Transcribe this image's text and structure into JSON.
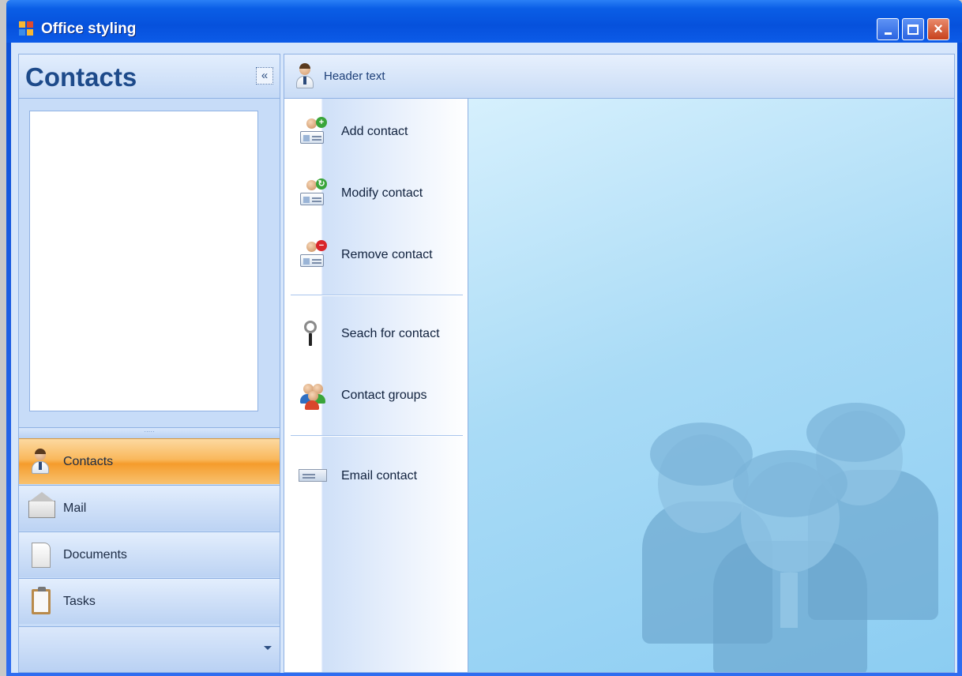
{
  "window": {
    "title": "Office styling"
  },
  "nav": {
    "title": "Contacts",
    "collapse_glyph": "«",
    "splitter_grip": "·····",
    "buttons": [
      {
        "label": "Contacts",
        "icon": "person-icon",
        "active": true
      },
      {
        "label": "Mail",
        "icon": "envelope-icon",
        "active": false
      },
      {
        "label": "Documents",
        "icon": "document-icon",
        "active": false
      },
      {
        "label": "Tasks",
        "icon": "clipboard-icon",
        "active": false
      }
    ]
  },
  "main": {
    "header_text": "Header text",
    "tasks": [
      {
        "label": "Add contact",
        "icon": "add-contact-icon"
      },
      {
        "label": "Modify contact",
        "icon": "modify-contact-icon"
      },
      {
        "label": "Remove contact",
        "icon": "remove-contact-icon"
      },
      {
        "label": "Seach for contact",
        "icon": "magnifier-icon"
      },
      {
        "label": "Contact groups",
        "icon": "contact-groups-icon"
      },
      {
        "label": "Email contact",
        "icon": "email-card-icon"
      }
    ]
  },
  "colors": {
    "titlebar": "#0651dc",
    "active_nav": "#f59c2c",
    "panel_border": "#8fb1e3",
    "content_bg": "#a9dbf6"
  }
}
